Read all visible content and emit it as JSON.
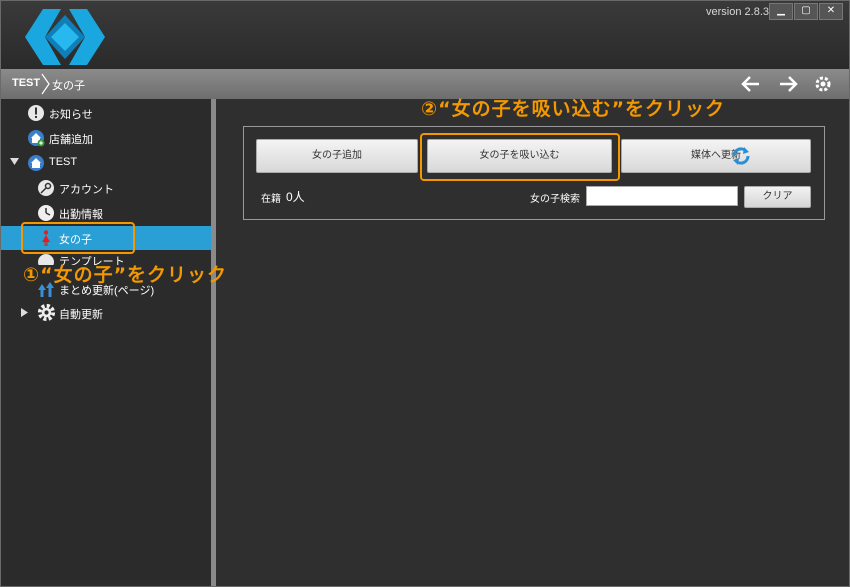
{
  "window": {
    "version": "version 2.8.3",
    "buttons": {
      "minimize": "▁",
      "maximize": "▢",
      "close": "✕"
    }
  },
  "breadcrumb": {
    "root": "TEST",
    "current": "女の子"
  },
  "sidebar": {
    "items": [
      {
        "label": "お知らせ"
      },
      {
        "label": "店舗追加"
      },
      {
        "label": "TEST"
      },
      {
        "label": "アカウント"
      },
      {
        "label": "出勤情報"
      },
      {
        "label": "女の子"
      },
      {
        "label": "テンプレート"
      },
      {
        "label": "まとめ更新(ページ)"
      },
      {
        "label": "自動更新"
      }
    ]
  },
  "main": {
    "add_girl_label": "女の子追加",
    "import_girl_label": "女の子を吸い込む",
    "update_media_label": "媒体へ更新",
    "enrolled_label": "在籍",
    "enrolled_count": "0人",
    "search_label": "女の子検索",
    "search_value": "",
    "clear_label": "クリア"
  },
  "annotations": {
    "step1": "①“女の子”をクリック",
    "step2": "②“女の子を吸い込む”をクリック"
  },
  "colors": {
    "accent": "#2a9fd6",
    "highlight": "#f39800"
  }
}
